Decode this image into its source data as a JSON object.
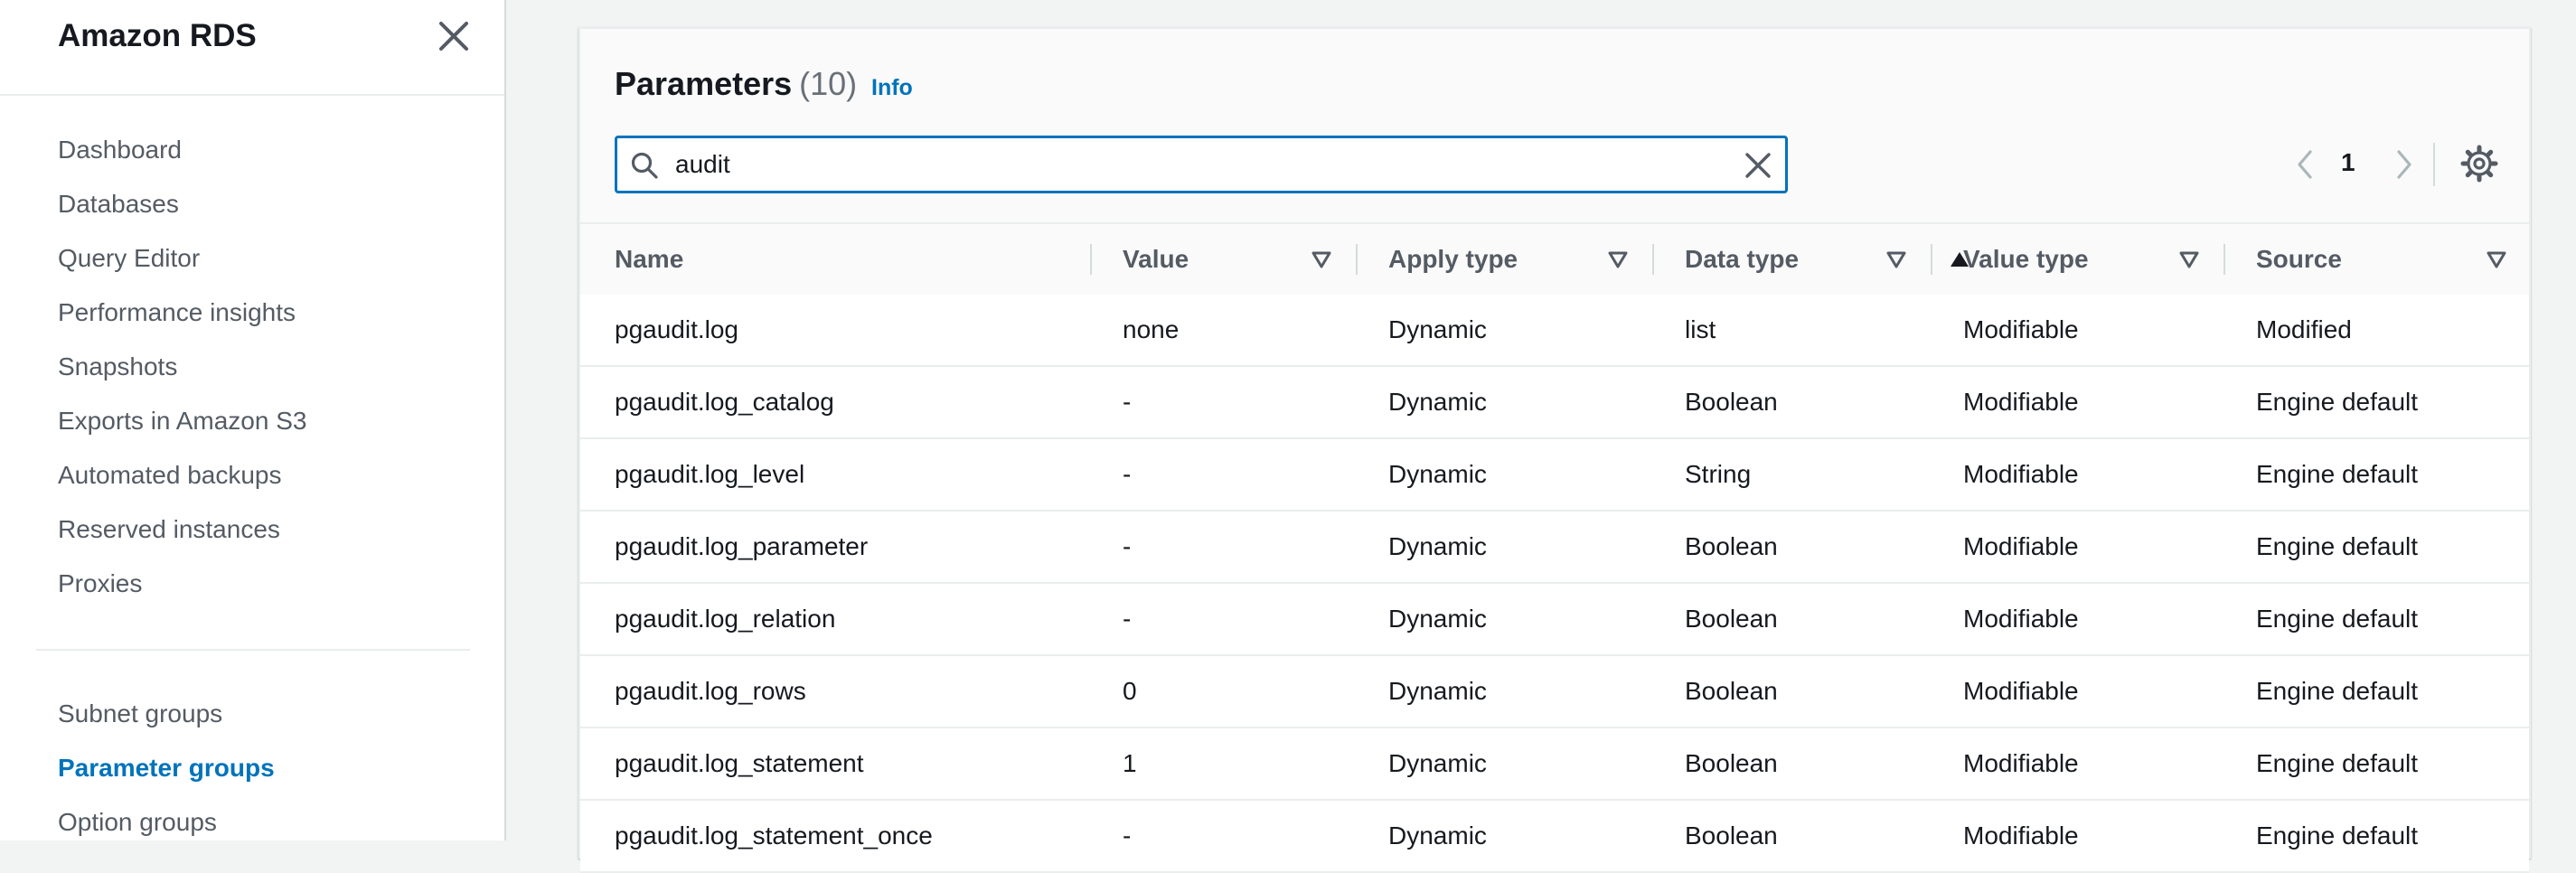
{
  "sidebar": {
    "title": "Amazon RDS",
    "items": [
      {
        "label": "Dashboard"
      },
      {
        "label": "Databases"
      },
      {
        "label": "Query Editor"
      },
      {
        "label": "Performance insights"
      },
      {
        "label": "Snapshots"
      },
      {
        "label": "Exports in Amazon S3"
      },
      {
        "label": "Automated backups"
      },
      {
        "label": "Reserved instances"
      },
      {
        "label": "Proxies"
      },
      {
        "label": "Subnet groups"
      },
      {
        "label": "Parameter groups",
        "active": true
      },
      {
        "label": "Option groups"
      }
    ]
  },
  "panel": {
    "title": "Parameters",
    "count": "(10)",
    "info_label": "Info"
  },
  "search": {
    "value": "audit",
    "placeholder": ""
  },
  "pager": {
    "current_page": "1"
  },
  "table": {
    "columns": [
      {
        "label": "Name",
        "sort": "ascending"
      },
      {
        "label": "Value"
      },
      {
        "label": "Apply type"
      },
      {
        "label": "Data type"
      },
      {
        "label": "Value type"
      },
      {
        "label": "Source"
      }
    ],
    "rows": [
      [
        "pgaudit.log",
        "none",
        "Dynamic",
        "list",
        "Modifiable",
        "Modified"
      ],
      [
        "pgaudit.log_catalog",
        "-",
        "Dynamic",
        "Boolean",
        "Modifiable",
        "Engine default"
      ],
      [
        "pgaudit.log_level",
        "-",
        "Dynamic",
        "String",
        "Modifiable",
        "Engine default"
      ],
      [
        "pgaudit.log_parameter",
        "-",
        "Dynamic",
        "Boolean",
        "Modifiable",
        "Engine default"
      ],
      [
        "pgaudit.log_relation",
        "-",
        "Dynamic",
        "Boolean",
        "Modifiable",
        "Engine default"
      ],
      [
        "pgaudit.log_rows",
        "0",
        "Dynamic",
        "Boolean",
        "Modifiable",
        "Engine default"
      ],
      [
        "pgaudit.log_statement",
        "1",
        "Dynamic",
        "Boolean",
        "Modifiable",
        "Engine default"
      ],
      [
        "pgaudit.log_statement_once",
        "-",
        "Dynamic",
        "Boolean",
        "Modifiable",
        "Engine default"
      ]
    ]
  },
  "colors": {
    "accent": "#0073bb",
    "text": "#16191f",
    "muted": "#545b64",
    "background": "#f2f3f3"
  },
  "icons": {
    "close": "close-icon",
    "search": "search-icon",
    "clear": "clear-icon",
    "prev": "chevron-left-icon",
    "next": "chevron-right-icon",
    "settings": "gear-icon",
    "sort_asc": "sort-ascending-icon",
    "sort": "sort-icon"
  }
}
